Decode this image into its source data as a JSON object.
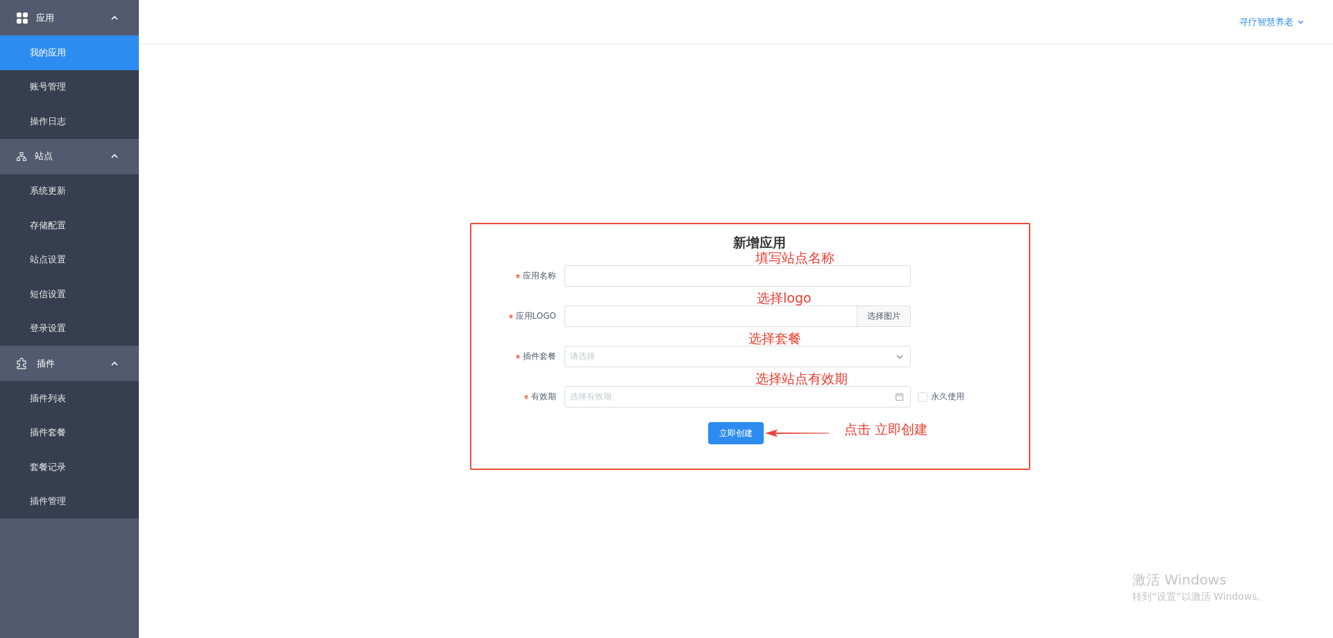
{
  "sidebar": {
    "groups": [
      {
        "label": "应用",
        "expanded": true,
        "items": [
          {
            "label": "我的应用",
            "selected": true
          },
          {
            "label": "账号管理",
            "selected": false
          },
          {
            "label": "操作日志",
            "selected": false
          }
        ]
      },
      {
        "label": "站点",
        "expanded": true,
        "items": [
          {
            "label": "系统更新",
            "selected": false
          },
          {
            "label": "存储配置",
            "selected": false
          },
          {
            "label": "站点设置",
            "selected": false
          },
          {
            "label": "短信设置",
            "selected": false
          },
          {
            "label": "登录设置",
            "selected": false
          }
        ]
      },
      {
        "label": "插件",
        "expanded": true,
        "items": [
          {
            "label": "插件列表",
            "selected": false
          },
          {
            "label": "插件套餐",
            "selected": false
          },
          {
            "label": "套餐记录",
            "selected": false
          },
          {
            "label": "插件管理",
            "selected": false
          }
        ]
      }
    ]
  },
  "header": {
    "user": "寻疗智慧养老"
  },
  "form": {
    "title": "新增应用",
    "fields": [
      {
        "kind": "text",
        "label": "应用名称",
        "required": true,
        "annotation": "填写站点名称"
      },
      {
        "kind": "file",
        "label": "应用LOGO",
        "required": true,
        "button": "选择图片",
        "annotation": "选择logo"
      },
      {
        "kind": "select",
        "label": "插件套餐",
        "required": true,
        "placeholder": "请选择",
        "annotation": "选择套餐"
      },
      {
        "kind": "date",
        "label": "有效期",
        "required": true,
        "placeholder": "选择有效期",
        "annotation": "选择站点有效期",
        "checkbox": {
          "label": "永久使用",
          "checked": false
        }
      }
    ],
    "submit": "立即创建",
    "submit_annotation": "点击 立即创建"
  },
  "os_notice": {
    "title": "激活 Windows",
    "text": "转到“设置”以激活 Windows。"
  }
}
